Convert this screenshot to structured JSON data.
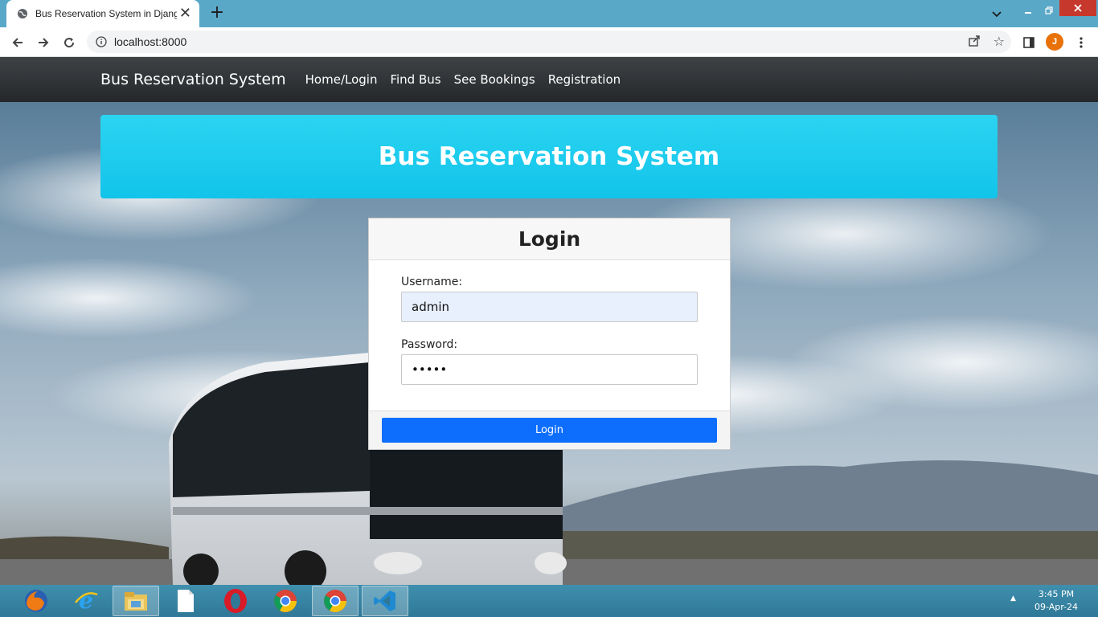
{
  "browser": {
    "tab_title": "Bus Reservation System in Djang",
    "tab_close": "✕",
    "new_tab": "+",
    "url": "localhost:8000",
    "profile_initial": "J"
  },
  "navbar": {
    "brand": "Bus Reservation System",
    "links": [
      "Home/Login",
      "Find Bus",
      "See Bookings",
      "Registration"
    ]
  },
  "hero": {
    "title": "Bus Reservation System"
  },
  "login_card": {
    "title": "Login",
    "username_label": "Username:",
    "username_value": "admin",
    "password_label": "Password:",
    "password_value": "•••••",
    "submit_label": "Login"
  },
  "taskbar": {
    "apps": [
      "firefox-icon",
      "internet-explorer-icon",
      "file-explorer-icon",
      "blank-document-icon",
      "opera-icon",
      "chrome-icon",
      "chrome-active-icon",
      "vscode-icon"
    ],
    "time": "3:45 PM",
    "date": "09-Apr-24"
  },
  "colors": {
    "navbar": "#2d3033",
    "hero": "#1ccbee",
    "button": "#0d6efd",
    "input_autofill": "#e8f0fe"
  }
}
